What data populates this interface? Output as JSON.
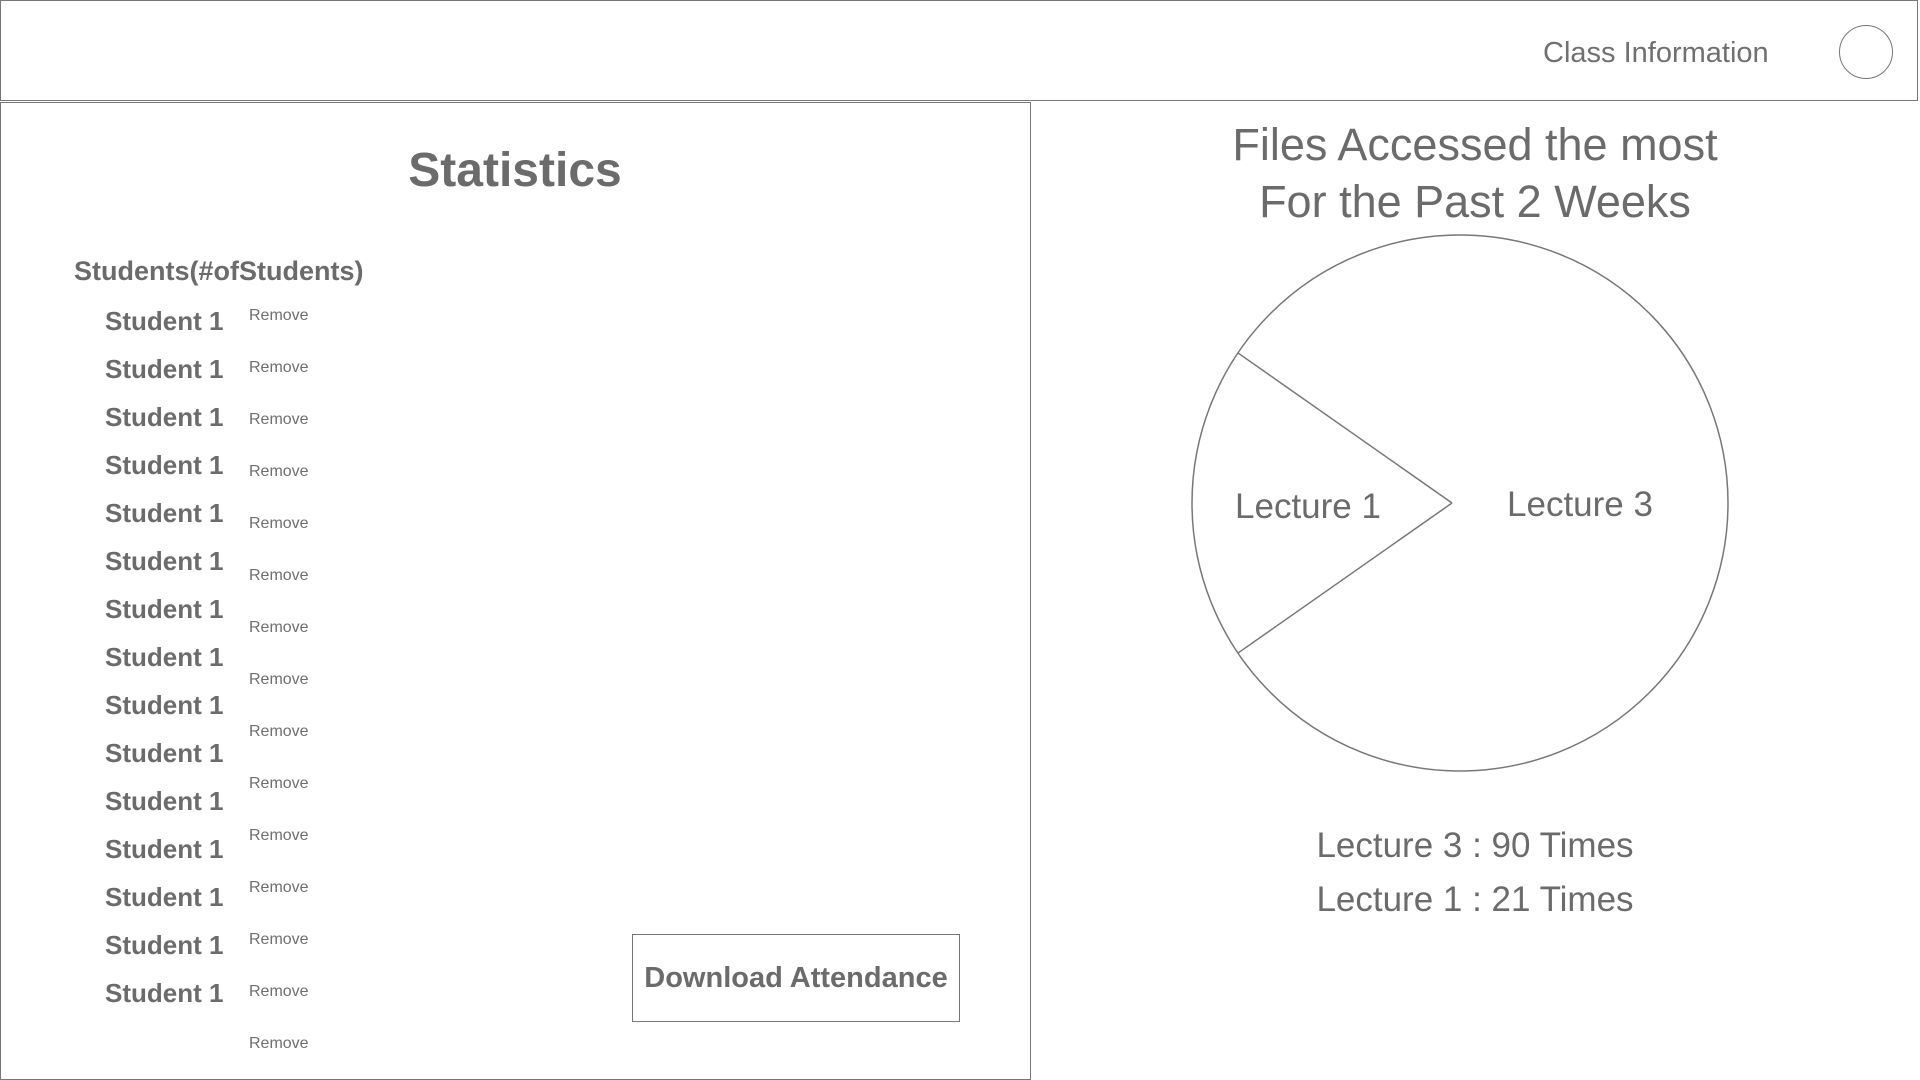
{
  "header": {
    "title": "Class Information",
    "avatar_icon": "user-avatar-circle"
  },
  "statistics": {
    "title": "Statistics",
    "students_heading": "Students(#ofStudents)",
    "remove_label": "Remove",
    "students": [
      "Student 1",
      "Student 1",
      "Student 1",
      "Student 1",
      "Student 1",
      "Student 1",
      "Student 1",
      "Student 1",
      "Student 1",
      "Student 1",
      "Student 1",
      "Student 1",
      "Student 1",
      "Student 1",
      "Student 1"
    ],
    "download_label": "Download Attendance"
  },
  "files": {
    "title_line1": "Files Accessed the most",
    "title_line2": "For the Past 2 Weeks",
    "legend": [
      "Lecture 3 : 90 Times",
      "Lecture 1 : 21 Times"
    ]
  },
  "chart_data": {
    "type": "pie",
    "title": "Files Accessed the most For the Past 2 Weeks",
    "slices": [
      {
        "label": "Lecture 3",
        "value": 90
      },
      {
        "label": "Lecture 1",
        "value": 21
      }
    ],
    "colors": {
      "stroke": "#777777",
      "fill": "#ffffff",
      "text": "#6b6b6b"
    }
  }
}
